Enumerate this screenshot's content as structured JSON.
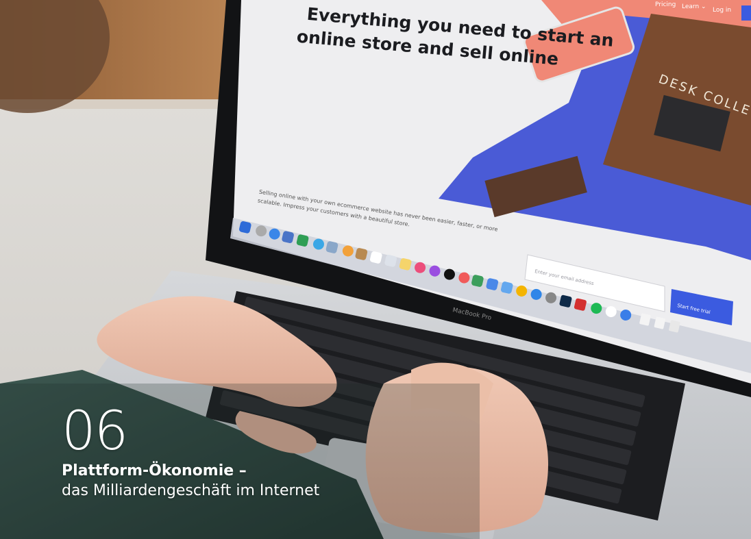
{
  "screen": {
    "nav_links": [
      "Pricing",
      "Learn ⌄",
      "Log in"
    ],
    "headline_line1": "Everything you need to start an",
    "headline_line2": "online store and sell online",
    "body_line1": "Selling online with your own ecommerce website has never been easier, faster, or more",
    "body_line2": "scalable. Impress your customers with a beautiful store.",
    "email_placeholder": "Enter your email address",
    "cta_label": "Start free trial",
    "artwork_text": "DESK COLLECTION"
  },
  "laptop": {
    "brand": "MacBook Pro"
  },
  "overlay": {
    "chapter_number": "06",
    "title": "Plattform-Ökonomie –",
    "subtitle": "das Milliardengeschäft im Internet"
  },
  "colors": {
    "screen_bg": "#eeeef0",
    "coral": "#f08876",
    "royal_blue": "#4a5bd6",
    "cta_blue": "#3b5be0",
    "laptop_silver": "#c9cbce",
    "bezel": "#111214",
    "sweater": "#2f4640",
    "desk": "#e4e1dc",
    "wood": "#b07a4d"
  }
}
